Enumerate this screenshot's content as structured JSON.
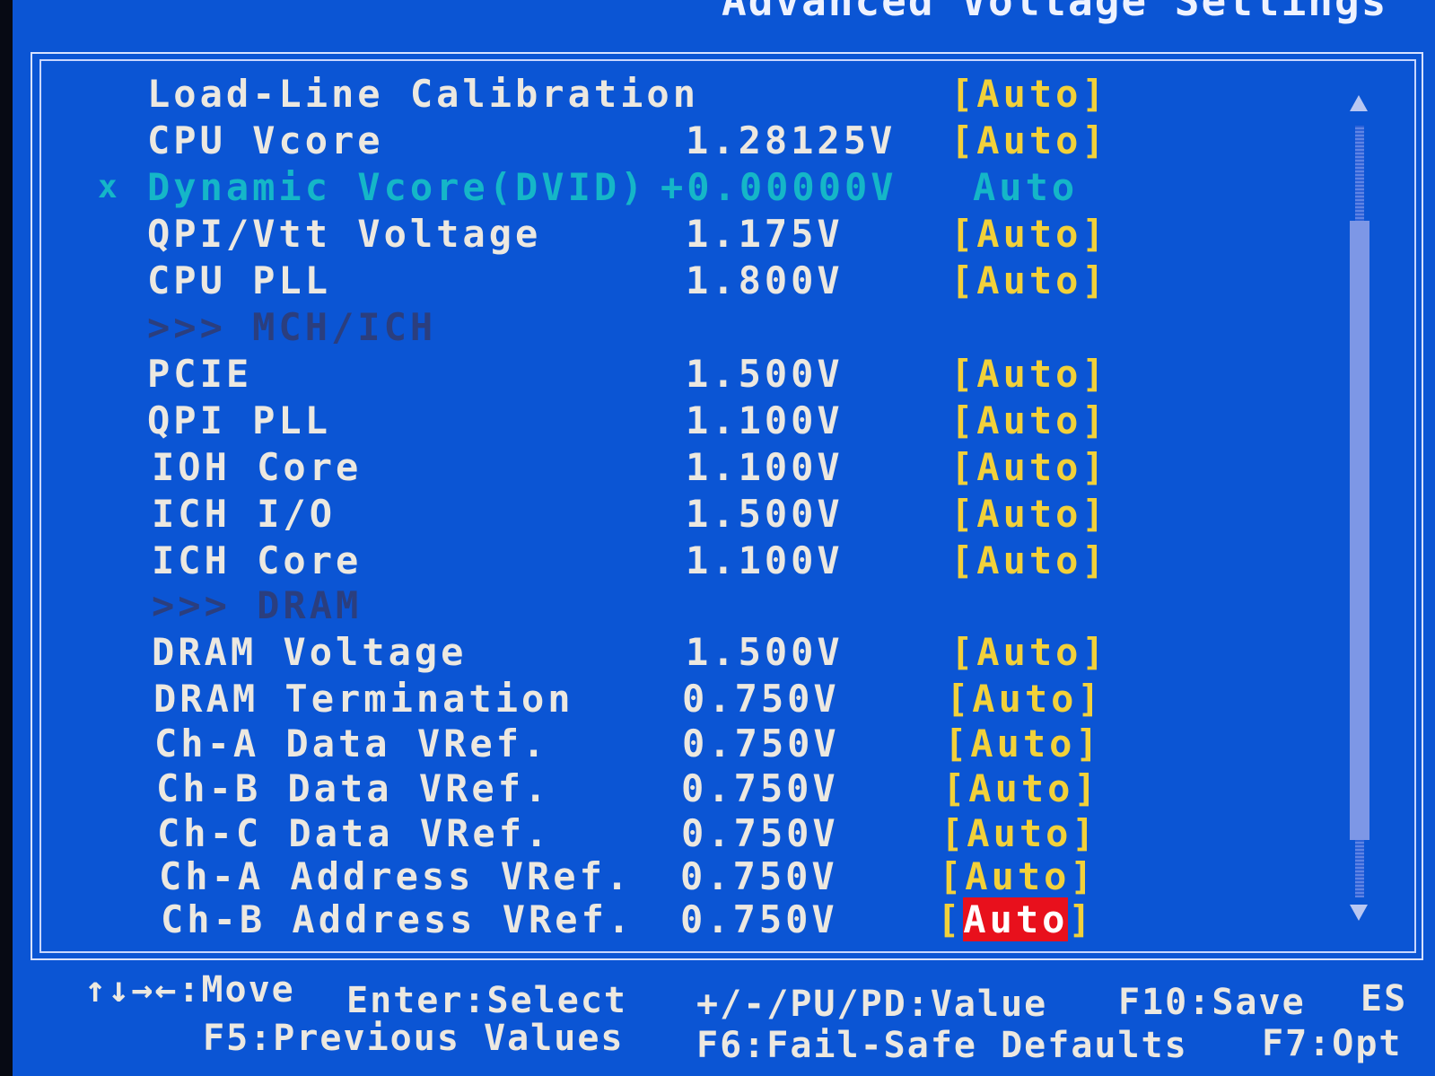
{
  "window": {
    "title": "Advanced Voltage Settings"
  },
  "settings": [
    {
      "label": "Load-Line Calibration",
      "value": "",
      "setting": "[Auto]"
    },
    {
      "label": "CPU Vcore",
      "value": "1.28125V",
      "setting": "[Auto]"
    },
    {
      "label": "Dynamic Vcore(DVID)",
      "value": "+0.00000V",
      "setting": "Auto",
      "mark": "x"
    },
    {
      "label": "QPI/Vtt Voltage",
      "value": "1.175V",
      "setting": "[Auto]"
    },
    {
      "label": "CPU PLL",
      "value": "1.800V",
      "setting": "[Auto]"
    },
    {
      "label": "PCIE",
      "value": "1.500V",
      "setting": "[Auto]"
    },
    {
      "label": "QPI PLL",
      "value": "1.100V",
      "setting": "[Auto]"
    },
    {
      "label": "IOH Core",
      "value": "1.100V",
      "setting": "[Auto]"
    },
    {
      "label": "ICH I/O",
      "value": "1.500V",
      "setting": "[Auto]"
    },
    {
      "label": "ICH Core",
      "value": "1.100V",
      "setting": "[Auto]"
    },
    {
      "label": "DRAM Voltage",
      "value": "1.500V",
      "setting": "[Auto]"
    },
    {
      "label": "DRAM Termination",
      "value": "0.750V",
      "setting": "[Auto]"
    },
    {
      "label": "Ch-A Data VRef.",
      "value": "0.750V",
      "setting": "[Auto]"
    },
    {
      "label": "Ch-B Data VRef.",
      "value": "0.750V",
      "setting": "[Auto]"
    },
    {
      "label": "Ch-C Data VRef.",
      "value": "0.750V",
      "setting": "[Auto]"
    },
    {
      "label": "Ch-A Address VRef.",
      "value": "0.750V",
      "setting": "[Auto]"
    },
    {
      "label": "Ch-B Address VRef.",
      "value": "0.750V",
      "setting_open": "[",
      "setting_selected": "Auto",
      "setting_close": "]"
    }
  ],
  "sections": {
    "mch_ich": ">>> MCH/ICH",
    "dram": ">>> DRAM"
  },
  "footer": {
    "move": "↑↓→←:Move",
    "select": "Enter:Select",
    "value": "+/-/PU/PD:Value",
    "save": "F10:Save",
    "esc": "ES",
    "previous": "F5:Previous Values",
    "failsafe": "F6:Fail-Safe Defaults",
    "optimized": "F7:Opt"
  },
  "colors": {
    "background": "#0b55d4",
    "label": "#ece8e0",
    "setting": "#f2d13a",
    "disabled": "#15b6c8",
    "section": "#2b3e7e",
    "selection": "#e8101c"
  }
}
